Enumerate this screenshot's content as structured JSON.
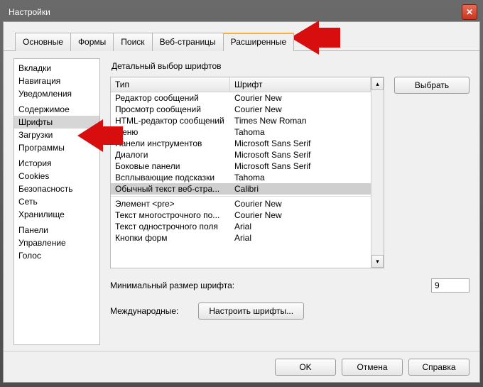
{
  "window": {
    "title": "Настройки"
  },
  "tabs": [
    {
      "label": "Основные"
    },
    {
      "label": "Формы"
    },
    {
      "label": "Поиск"
    },
    {
      "label": "Веб-страницы"
    },
    {
      "label": "Расширенные",
      "active": true
    }
  ],
  "sidebar": {
    "groups": [
      [
        "Вкладки",
        "Навигация",
        "Уведомления"
      ],
      [
        "Содержимое",
        "Шрифты",
        "Загрузки",
        "Программы"
      ],
      [
        "История",
        "Cookies",
        "Безопасность",
        "Сеть",
        "Хранилище"
      ],
      [
        "Панели",
        "Управление",
        "Голос"
      ]
    ],
    "selected": "Шрифты"
  },
  "center": {
    "title": "Детальный выбор шрифтов",
    "columns": {
      "c1": "Тип",
      "c2": "Шрифт"
    },
    "rows": [
      {
        "type": "Редактор сообщений",
        "font": "Courier New"
      },
      {
        "type": "Просмотр сообщений",
        "font": "Courier New"
      },
      {
        "type": "HTML-редактор сообщений",
        "font": "Times New Roman"
      },
      {
        "type": "Меню",
        "font": "Tahoma"
      },
      {
        "type": "Панели инструментов",
        "font": "Microsoft Sans Serif"
      },
      {
        "type": "Диалоги",
        "font": "Microsoft Sans Serif"
      },
      {
        "type": "Боковые панели",
        "font": "Microsoft Sans Serif"
      },
      {
        "type": "Всплывающие подсказки",
        "font": "Tahoma"
      },
      {
        "type": "Обычный текст веб-стра...",
        "font": "Calibri",
        "selected": true
      },
      {
        "sep": true
      },
      {
        "type": "Элемент <pre>",
        "font": "Courier New"
      },
      {
        "type": "Текст многострочного по...",
        "font": "Courier New"
      },
      {
        "type": "Текст однострочного поля",
        "font": "Arial"
      },
      {
        "type": "Кнопки форм",
        "font": "Arial"
      }
    ],
    "choose_btn": "Выбрать",
    "min_size_label": "Минимальный размер шрифта:",
    "min_size_value": "9",
    "intl_label": "Международные:",
    "intl_btn": "Настроить шрифты..."
  },
  "footer": {
    "ok": "OK",
    "cancel": "Отмена",
    "help": "Справка"
  }
}
